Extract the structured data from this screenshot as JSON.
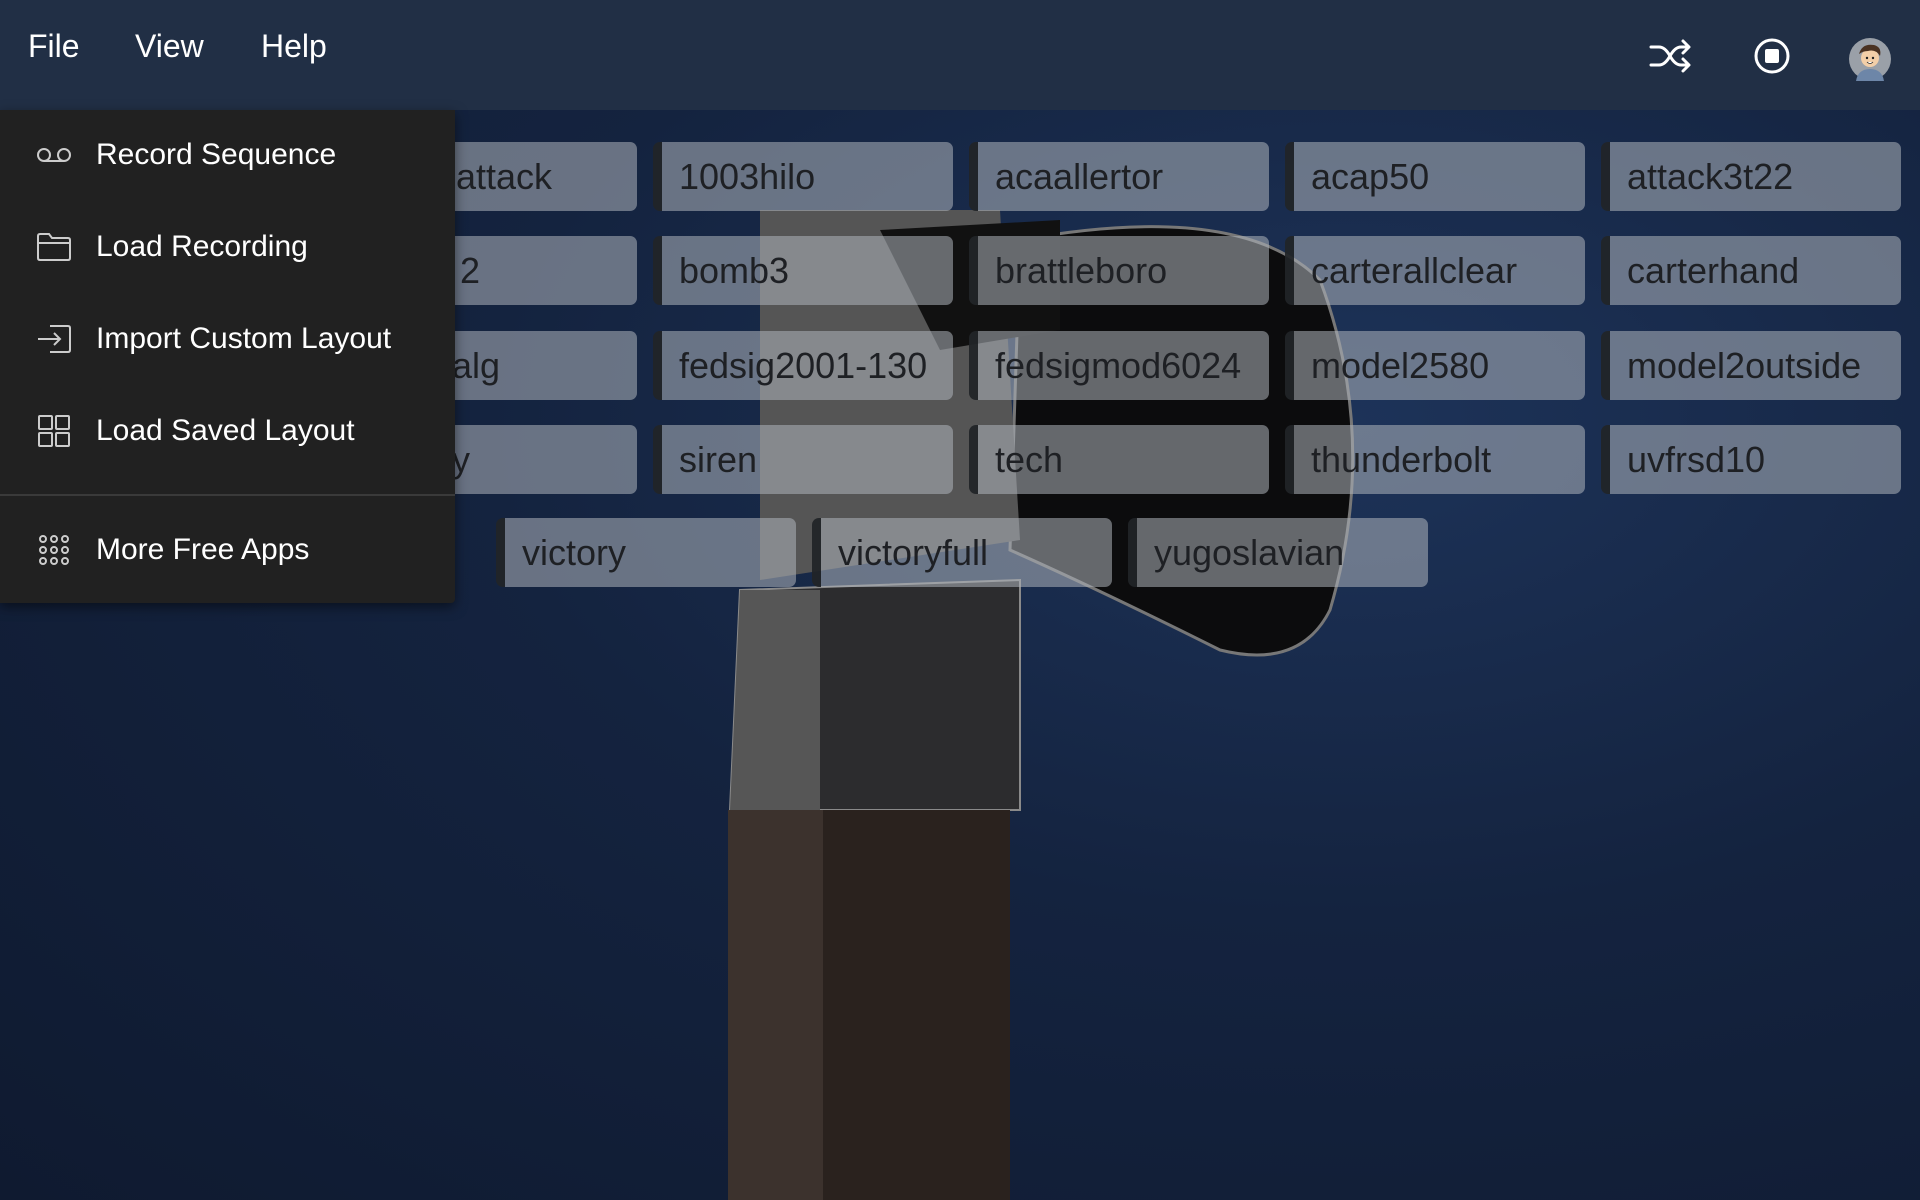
{
  "menubar": {
    "items": [
      {
        "label": "File"
      },
      {
        "label": "View"
      },
      {
        "label": "Help"
      }
    ]
  },
  "header_icons": [
    "shuffle-icon",
    "stop-icon",
    "avatar"
  ],
  "file_menu": {
    "items": [
      {
        "label": "Record Sequence",
        "icon": "voicemail-icon"
      },
      {
        "label": "Load Recording",
        "icon": "folder-icon"
      },
      {
        "label": "Import Custom Layout",
        "icon": "import-icon"
      },
      {
        "label": "Load Saved Layout",
        "icon": "grid-icon"
      },
      {
        "label": "More Free Apps",
        "icon": "apps-icon"
      }
    ]
  },
  "sounds": {
    "rows": [
      [
        "attack",
        "1003hilo",
        "acaallertor",
        "acap50",
        "attack3t22"
      ],
      [
        "2",
        "bomb3",
        "brattleboro",
        "carterallclear",
        "carterhand"
      ],
      [
        "alg",
        "fedsig2001-130",
        "fedsigmod6024",
        "model2580",
        "model2outside"
      ],
      [
        "y",
        "siren",
        "tech",
        "thunderbolt",
        "uvfrsd10"
      ],
      [
        "victory",
        "victoryfull",
        "yugoslavian"
      ]
    ]
  },
  "colors": {
    "header": "#212f45",
    "menu_bg": "#212121",
    "background": "#14233f"
  }
}
